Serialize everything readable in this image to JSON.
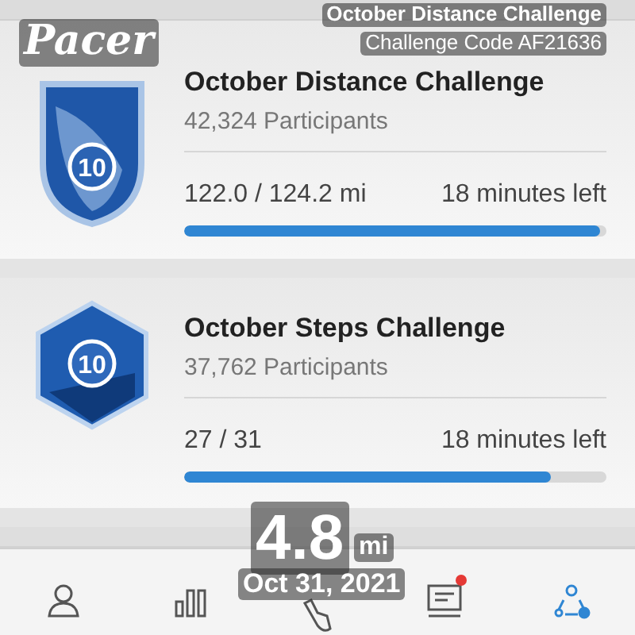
{
  "challenges": [
    {
      "kind": "shield",
      "title": "October Distance Challenge",
      "badge": "10",
      "participants": "42,324 Participants",
      "progress": "122.0 / 124.2 mi",
      "time_left": "18 minutes left",
      "level": 0.985
    },
    {
      "kind": "hexagon",
      "title": "October Steps Challenge",
      "badge": "10",
      "participants": "37,762 Participants",
      "progress": "27 / 31",
      "time_left": "18 minutes left",
      "level": 0.87
    }
  ],
  "overlay": {
    "logo": "Pacer",
    "title": "October Distance Challenge",
    "code": "Challenge Code AF21636",
    "distance": "4.8",
    "unit": "mi",
    "date": "Oct 31, 2021"
  },
  "nav": [
    {
      "kind": "person",
      "selected": false,
      "alert": false
    },
    {
      "kind": "bars",
      "selected": false,
      "alert": false
    },
    {
      "kind": "shoe",
      "selected": false,
      "alert": false
    },
    {
      "kind": "inbox",
      "selected": false,
      "alert": true
    },
    {
      "kind": "group",
      "selected": true,
      "alert": false
    }
  ]
}
